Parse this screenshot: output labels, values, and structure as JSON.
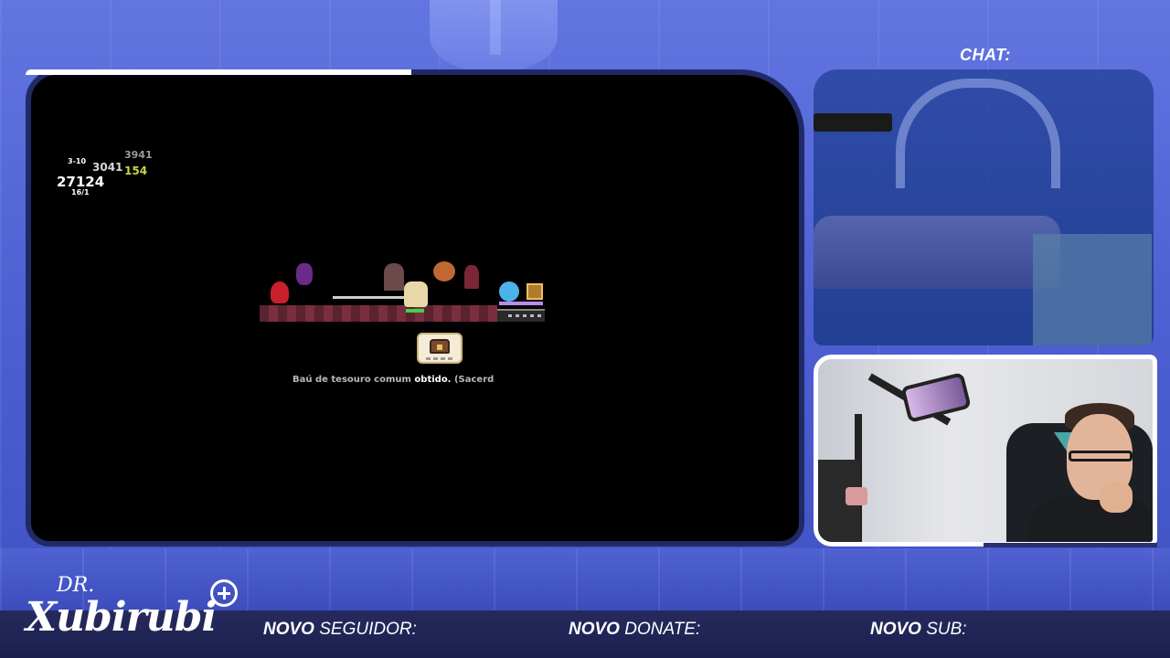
{
  "game": {
    "stage": "3-10",
    "num_a": "3941",
    "num_b": "3041",
    "num_c": "154",
    "num_d": "27124",
    "counter": "16/1",
    "loot_message_pre": "Baú de tesouro comum ",
    "loot_message_hl": "obtido.",
    "loot_message_post": " (Sacerd"
  },
  "chat": {
    "label": "CHAT:"
  },
  "branding": {
    "prefix": "DR.",
    "name": "Xubirubi"
  },
  "alerts": {
    "seguidor_bold": "NOVO",
    "seguidor_rest": " SEGUIDOR:",
    "donate_bold": "NOVO",
    "donate_rest": " DONATE:",
    "sub_bold": "NOVO",
    "sub_rest": " SUB:"
  },
  "colors": {
    "overlay_blue": "#4456c6",
    "bar_navy": "#1c2050",
    "hp_green": "#3fd24a"
  },
  "icons": [
    "treasure-chest-icon",
    "plus-circle-icon"
  ]
}
